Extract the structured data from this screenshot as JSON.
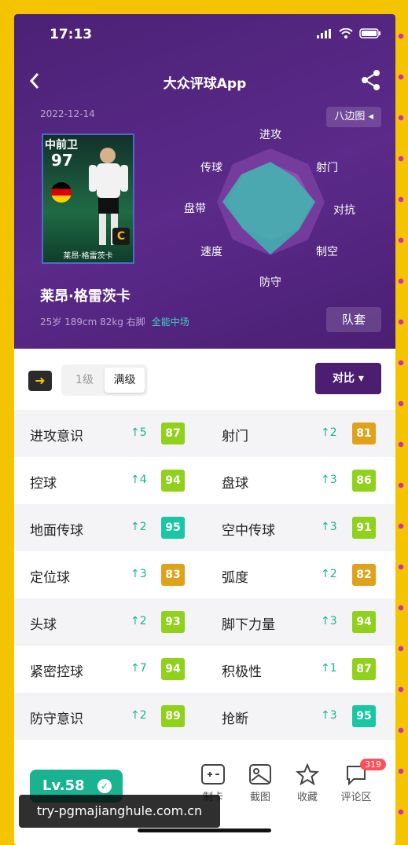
{
  "status_bar": {
    "time": "17:13"
  },
  "nav": {
    "title": "大众评球App"
  },
  "header": {
    "date": "2022-12-14",
    "chart_switch": "八边图 ◂"
  },
  "card": {
    "position": "中前卫",
    "rating": "97",
    "badge": "C",
    "name": "莱昂·格雷茨卡"
  },
  "player": {
    "name": "莱昂·格雷茨卡",
    "info": "25岁 189cm 82kg 右脚",
    "role": "全能中场",
    "team_button": "队套"
  },
  "radar_labels": [
    "进攻",
    "射门",
    "对抗",
    "制空",
    "防守",
    "速度",
    "盘带",
    "传球"
  ],
  "controls": {
    "arrow": "➜",
    "level_1": "1级",
    "level_max": "满级",
    "compare": "对比 ▾"
  },
  "stats": [
    [
      {
        "label": "进攻意识",
        "gain": "↑5",
        "value": "87",
        "color": "#8fd11b"
      },
      {
        "label": "射门",
        "gain": "↑2",
        "value": "81",
        "color": "#e0a21b"
      }
    ],
    [
      {
        "label": "控球",
        "gain": "↑4",
        "value": "94",
        "color": "#8fd11b"
      },
      {
        "label": "盘球",
        "gain": "↑3",
        "value": "86",
        "color": "#8fd11b"
      }
    ],
    [
      {
        "label": "地面传球",
        "gain": "↑2",
        "value": "95",
        "color": "#19c7a5"
      },
      {
        "label": "空中传球",
        "gain": "↑3",
        "value": "91",
        "color": "#8fd11b"
      }
    ],
    [
      {
        "label": "定位球",
        "gain": "↑3",
        "value": "83",
        "color": "#e0a21b"
      },
      {
        "label": "弧度",
        "gain": "↑2",
        "value": "82",
        "color": "#e0a21b"
      }
    ],
    [
      {
        "label": "头球",
        "gain": "↑2",
        "value": "93",
        "color": "#8fd11b"
      },
      {
        "label": "脚下力量",
        "gain": "↑3",
        "value": "94",
        "color": "#8fd11b"
      }
    ],
    [
      {
        "label": "紧密控球",
        "gain": "↑7",
        "value": "94",
        "color": "#8fd11b"
      },
      {
        "label": "积极性",
        "gain": "↑1",
        "value": "87",
        "color": "#8fd11b"
      }
    ],
    [
      {
        "label": "防守意识",
        "gain": "↑2",
        "value": "89",
        "color": "#8fd11b"
      },
      {
        "label": "抢断",
        "gain": "↑3",
        "value": "95",
        "color": "#19c7a5"
      }
    ]
  ],
  "bottom": {
    "level": "Lv.58",
    "tabs": {
      "card": "制卡",
      "screenshot": "截图",
      "favorite": "收藏",
      "comments": "评论区"
    },
    "comment_count": "319"
  },
  "watermark": "try-pgmajianghule.com.cn"
}
